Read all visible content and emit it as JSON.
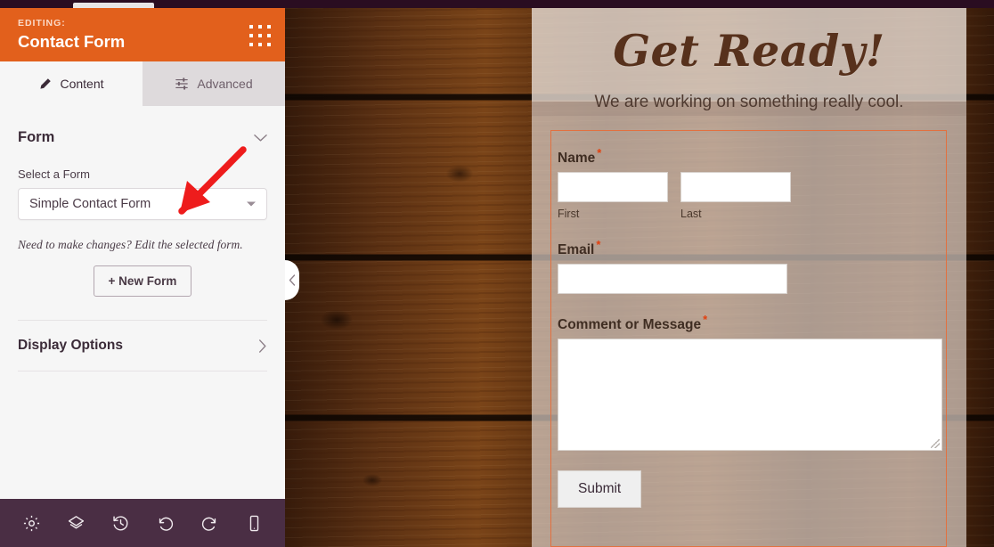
{
  "window": {
    "top_tab_label": ""
  },
  "sidebar": {
    "header": {
      "editing_label": "EDITING:",
      "title": "Contact Form",
      "drag_icon": "grid-dots-icon"
    },
    "tabs": [
      {
        "label": "Content",
        "icon": "pencil-icon",
        "active": true
      },
      {
        "label": "Advanced",
        "icon": "sliders-icon",
        "active": false
      }
    ],
    "form_section": {
      "title": "Form",
      "collapse_icon": "chevron-down-icon",
      "select_label": "Select a Form",
      "select_value": "Simple Contact Form",
      "select_caret_icon": "caret-down-icon",
      "helper_text": "Need to make changes? Edit the selected form.",
      "new_form_button": "+ New Form"
    },
    "display_options": {
      "title": "Display Options",
      "expand_icon": "chevron-right-icon"
    },
    "footer_icons": [
      {
        "name": "gear-icon",
        "glyph": "settings"
      },
      {
        "name": "layers-icon",
        "glyph": "layers"
      },
      {
        "name": "history-icon",
        "glyph": "history"
      },
      {
        "name": "undo-icon",
        "glyph": "undo"
      },
      {
        "name": "redo-icon",
        "glyph": "redo"
      },
      {
        "name": "mobile-icon",
        "glyph": "mobile"
      }
    ]
  },
  "preview": {
    "collapse_handle_icon": "chevron-left-icon",
    "hero": {
      "title": "Get Ready!",
      "subtitle": "We are working on something really cool."
    },
    "contact_form": {
      "selected_outline_color": "#e2703f",
      "fields": [
        {
          "label": "Name",
          "required": true,
          "required_mark": "*",
          "type": "name-split",
          "value": "",
          "sublabels": [
            "First",
            "Last"
          ]
        },
        {
          "label": "Email",
          "required": true,
          "required_mark": "*",
          "type": "text",
          "value": ""
        },
        {
          "label": "Comment or Message",
          "required": true,
          "required_mark": "*",
          "type": "textarea",
          "value": ""
        }
      ],
      "submit_label": "Submit"
    }
  },
  "annotation": {
    "type": "arrow",
    "color": "#ee1c1c",
    "points_at": "Simple Contact Form dropdown"
  },
  "colors": {
    "header_orange": "#e2601c",
    "footer_purple": "#4a2e44",
    "top_strip": "#2a0d21",
    "sidebar_bg": "#f6f6f6",
    "tab_inactive": "#dedadc",
    "required_red": "#e2400f",
    "hero_brown": "#57311c"
  }
}
